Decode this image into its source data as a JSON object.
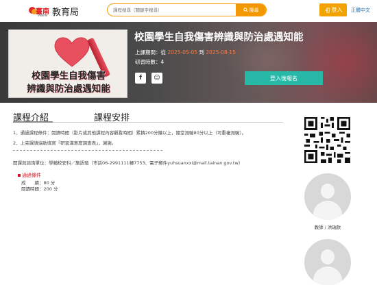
{
  "header": {
    "logo_cn": "臺南",
    "logo_en": "TAINAN",
    "logo_text": "教育局",
    "search_placeholder": "課程搜尋（關鍵字搜尋）",
    "search_button": "搜尋",
    "login_button": "登入",
    "language": "正體中文"
  },
  "banner": {
    "thumbnail_line1": "校園學生自我傷害",
    "thumbnail_line2": "辨識與防治處遇知能",
    "title": "校園學生自我傷害辨識與防治處遇知能",
    "period_label": "上課期間：從",
    "start_date": "2025-05-05",
    "period_to": "到",
    "end_date": "2025-08-15",
    "hours_text": "研習時數：4",
    "share_fb": "f",
    "share_line": "☺",
    "enroll_button": "登入後報名"
  },
  "tabs": {
    "intro": "課程介紹",
    "schedule": "課程安排"
  },
  "content": {
    "line1": "1、通過課程條件：閱讀時間（影片或其他課程內容觀看時間）累積200分鐘以上，隨堂測驗80分以上（可重複測驗）。",
    "line2": "2、上完課請協助填寫「研習滿意度調查表」，謝謝。",
    "contact": "開課與諮詢單位：學輔校安科／施語瑄（市話06-2991111轉7753、電子郵件yuhsuanxxi@mail.tainan.gov.tw）",
    "pass_title": "通過條件",
    "pass_score": "成　　績：80 分",
    "pass_time": "閱讀時間：200 分"
  },
  "sidebar": {
    "teacher_label": "教師 / 洪瑞欽"
  },
  "colors": {
    "accent_orange": "#f39800",
    "enroll_teal": "#28b8a8",
    "date_orange": "#ff7a45",
    "pass_red": "#d0151f"
  }
}
